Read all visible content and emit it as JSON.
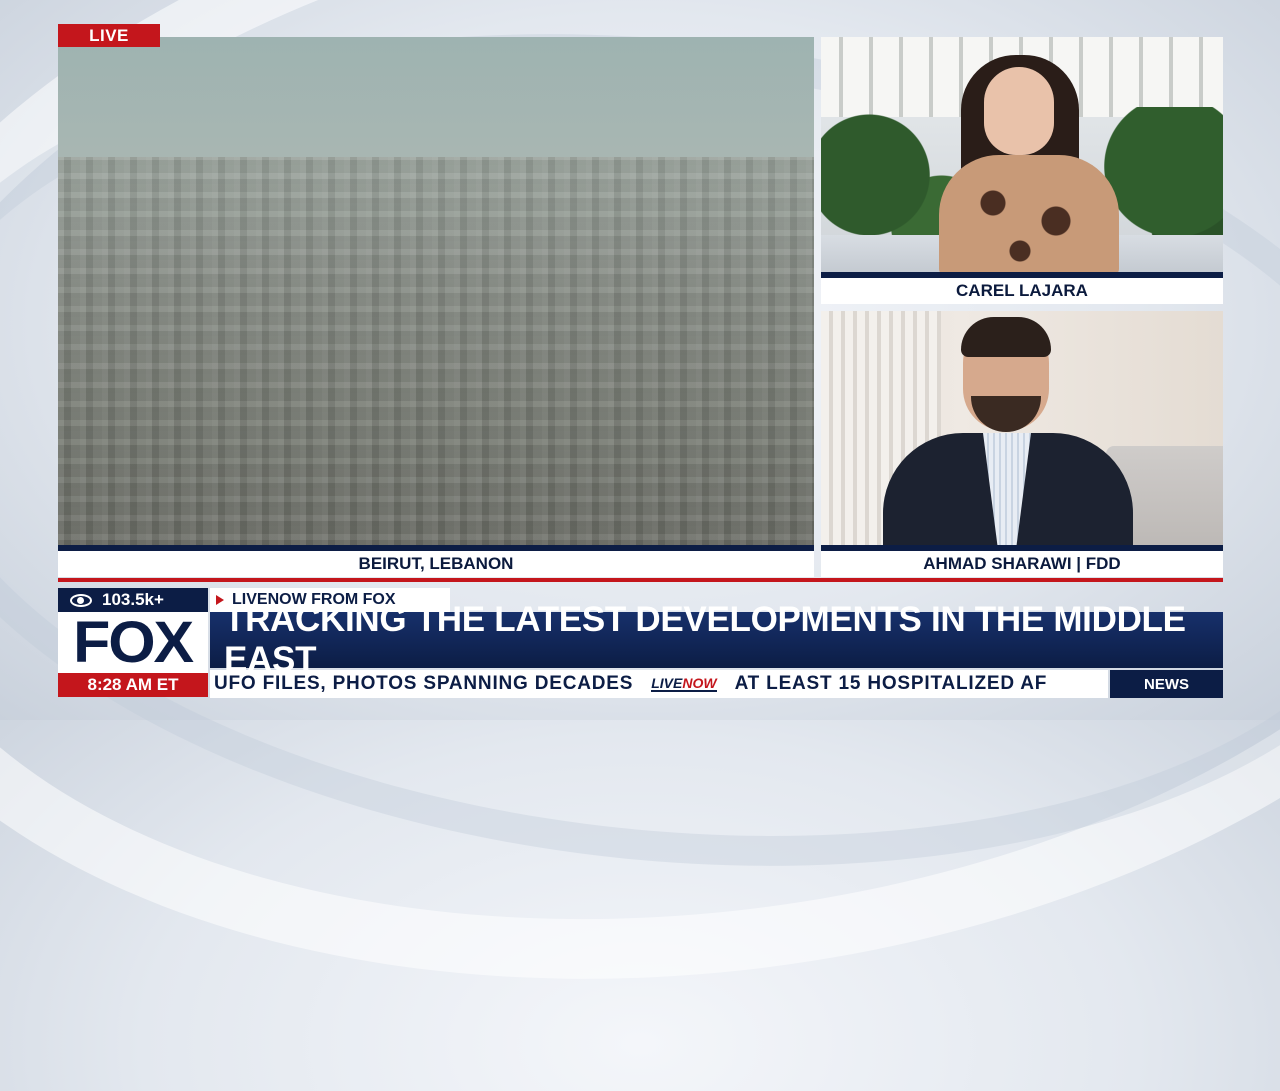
{
  "live_badge": "LIVE",
  "main_feed": {
    "caption": "BEIRUT, LEBANON"
  },
  "anchor_feed": {
    "caption": "CAREL LAJARA"
  },
  "guest_feed": {
    "caption": "AHMAD SHARAWI | FDD"
  },
  "viewers": {
    "count": "103.5k+",
    "icon": "eye-icon"
  },
  "livenow_tag": "LIVENOW FROM FOX",
  "logo": "FOX",
  "time": "8:28 AM ET",
  "headline": "TRACKING THE LATEST DEVELOPMENTS IN THE MIDDLE EAST",
  "ticker": {
    "item1": "UFO FILES, PHOTOS SPANNING DECADES",
    "separator_live": "LIVE",
    "separator_now": "NOW",
    "item2": "AT LEAST 15 HOSPITALIZED AF",
    "section": "NEWS"
  },
  "colors": {
    "navy": "#0c1d45",
    "red": "#c4161c",
    "white": "#ffffff"
  }
}
